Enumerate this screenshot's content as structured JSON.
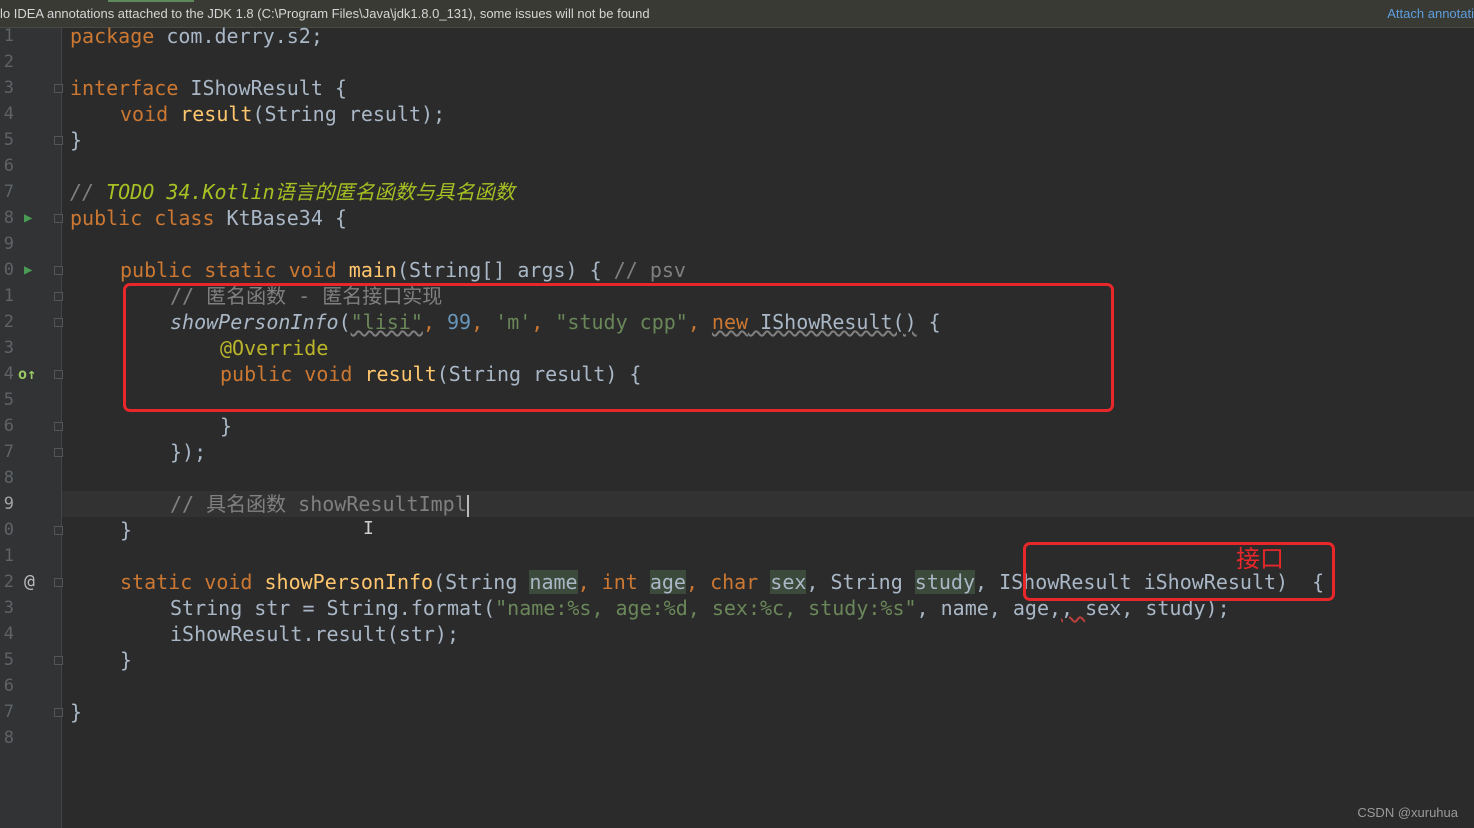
{
  "banner": {
    "message": "lo IDEA annotations attached to the JDK 1.8 (C:\\Program Files\\Java\\jdk1.8.0_131), some issues will not be found",
    "action": "Attach annotati"
  },
  "gutter": {
    "line_numbers": [
      "1",
      "2",
      "3",
      "4",
      "5",
      "6",
      "7",
      "8",
      "9",
      "0",
      "1",
      "2",
      "3",
      "4",
      "5",
      "6",
      "7",
      "8",
      "9",
      "0",
      "1",
      "2",
      "3",
      "4",
      "5",
      "6",
      "7",
      "8"
    ],
    "run_icon": "run-icon",
    "override_icon": "override-icon",
    "at_icon": "at-icon"
  },
  "code": {
    "l1": {
      "kw": "package",
      "rest": " com.derry.s2;"
    },
    "l3": {
      "kw": "interface",
      "rest": " IShowResult {"
    },
    "l4": {
      "kw": "void",
      "fn": "result",
      "rest": "(String result);"
    },
    "l5": "}",
    "l7": {
      "slashes": "// ",
      "todo": "TODO 34.Kotlin语言的匿名函数与具名函数"
    },
    "l8": {
      "kw": "public class",
      "rest": " KtBase34 {"
    },
    "l10": {
      "kw": "public static void",
      "fn": "main",
      "rest": "(String[] args) { ",
      "comment": "// psv"
    },
    "l11": {
      "comment": "// 匿名函数 - 匿名接口实现"
    },
    "l12": {
      "fn": "showPersonInfo",
      "open": "(",
      "s1": "\"lisi\"",
      "c1": ", ",
      "n1": "99",
      "c2": ", ",
      "s2": "'m'",
      "c3": ", ",
      "s3": "\"study cpp\"",
      "c4": ", ",
      "kwnew": "new",
      "iface": " IShowResult()",
      "tail": " {"
    },
    "l13": {
      "ann": "@Override"
    },
    "l14": {
      "kw": "public void",
      "fn": "result",
      "rest": "(String result) {"
    },
    "l16": "}",
    "l17": "});",
    "l19": {
      "comment": "// 具名函数 showResultImpl"
    },
    "l20": "}",
    "l22": {
      "kw": "static void",
      "fn": "showPersonInfo",
      "p1": "(String ",
      "name": "name",
      "p2": ", ",
      "kint": "int",
      "p3": " ",
      "age": "age",
      "p4": ", ",
      "kchar": "char",
      "p5": " ",
      "sex": "sex",
      "p6": ", String ",
      "study": "study",
      "p7": ", IShowResult iShowResult)  {"
    },
    "l23": {
      "a": "String str = String.format(",
      "s": "\"name:%s, age:%d, sex:%c, study:%s\"",
      "b": ", name, age,",
      "c": ", ",
      "d": "sex, study);"
    },
    "l24": "iShowResult.result(str);",
    "l25": "}",
    "l27": "}"
  },
  "annotations": {
    "interface_label": "接口"
  },
  "cursor_glyph": "I",
  "watermark": "CSDN @xuruhua",
  "colors": {
    "background": "#2b2b2b",
    "keyword": "#cc7832",
    "function": "#ffc66d",
    "string": "#6a8759",
    "number": "#6897bb",
    "comment": "#808080",
    "todo": "#a8c023",
    "highlight_box": "#e8272a"
  }
}
